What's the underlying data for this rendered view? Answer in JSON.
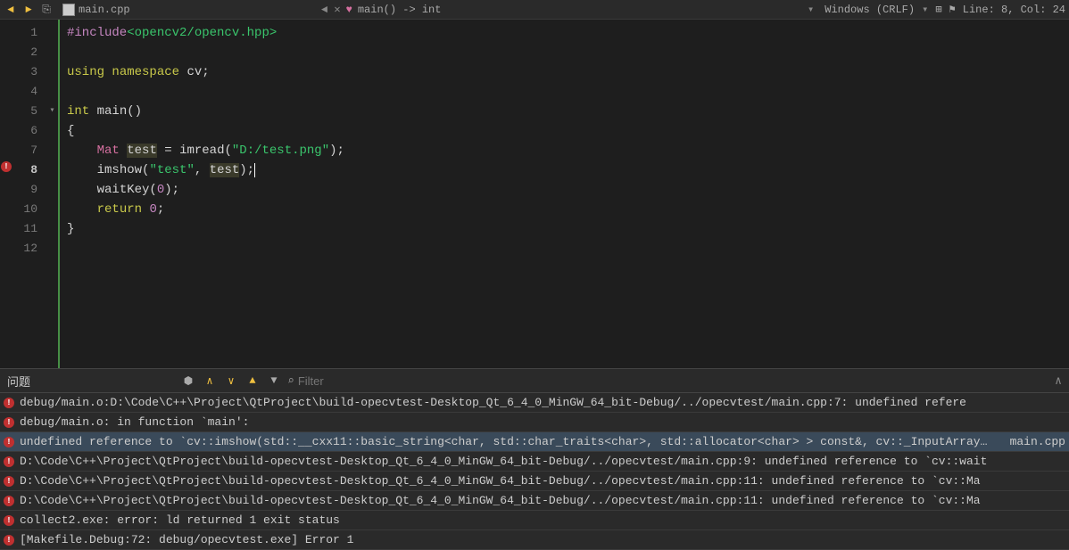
{
  "topbar": {
    "file_name": "main.cpp",
    "breadcrumb": "main() -> int",
    "encoding": "Windows (CRLF)",
    "cursor_pos": "Line: 8, Col: 24"
  },
  "editor": {
    "current_line": 8,
    "error_line": 8,
    "lines": [
      1,
      2,
      3,
      4,
      5,
      6,
      7,
      8,
      9,
      10,
      11,
      12
    ],
    "code": {
      "l1_include": "#include",
      "l1_header": "<opencv2/opencv.hpp>",
      "l3_using": "using",
      "l3_ns": "namespace",
      "l3_cv": "cv",
      "l5_int": "int",
      "l5_main": "main",
      "l7_mat": "Mat",
      "l7_test": "test",
      "l7_eq": " = ",
      "l7_imread": "imread",
      "l7_str": "\"D:/test.png\"",
      "l8_imshow": "imshow",
      "l8_str": "\"test\"",
      "l8_test": "test",
      "l9_waitkey": "waitKey",
      "l9_zero": "0",
      "l10_return": "return",
      "l10_zero": "0"
    }
  },
  "issues": {
    "title": "问题",
    "filter_placeholder": "Filter",
    "items": [
      {
        "msg": "debug/main.o:D:\\Code\\C++\\Project\\QtProject\\build-opecvtest-Desktop_Qt_6_4_0_MinGW_64_bit-Debug/../opecvtest/main.cpp:7: undefined refere",
        "file": ""
      },
      {
        "msg": "debug/main.o: in function `main':",
        "file": ""
      },
      {
        "msg": "undefined reference to `cv::imshow(std::__cxx11::basic_string<char, std::char_traits<char>, std::allocator<char> > const&, cv::_InputArray const&)'",
        "file": "main.cpp"
      },
      {
        "msg": "D:\\Code\\C++\\Project\\QtProject\\build-opecvtest-Desktop_Qt_6_4_0_MinGW_64_bit-Debug/../opecvtest/main.cpp:9: undefined reference to `cv::wait",
        "file": ""
      },
      {
        "msg": "D:\\Code\\C++\\Project\\QtProject\\build-opecvtest-Desktop_Qt_6_4_0_MinGW_64_bit-Debug/../opecvtest/main.cpp:11: undefined reference to `cv::Ma",
        "file": ""
      },
      {
        "msg": "D:\\Code\\C++\\Project\\QtProject\\build-opecvtest-Desktop_Qt_6_4_0_MinGW_64_bit-Debug/../opecvtest/main.cpp:11: undefined reference to `cv::Ma",
        "file": ""
      },
      {
        "msg": "collect2.exe: error: ld returned 1 exit status",
        "file": ""
      },
      {
        "msg": "[Makefile.Debug:72: debug/opecvtest.exe] Error 1",
        "file": ""
      }
    ]
  }
}
